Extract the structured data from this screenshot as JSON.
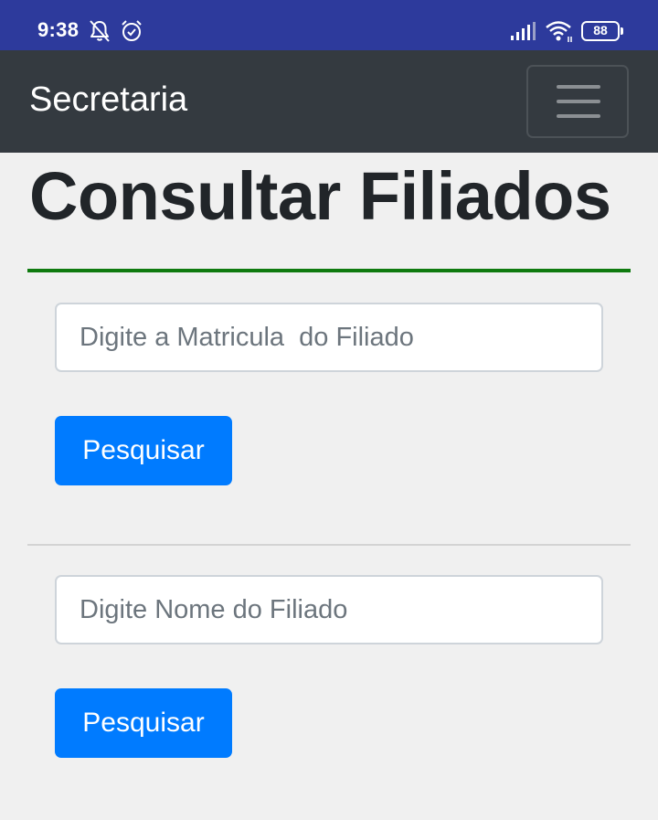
{
  "status_bar": {
    "time": "9:38",
    "battery_level": "88",
    "icons": [
      "bell-off-icon",
      "alarm-icon",
      "signal-icon",
      "wifi-icon",
      "battery-icon"
    ],
    "background_color": "#2d3a9c"
  },
  "navbar": {
    "brand": "Secretaria",
    "menu_icon": "hamburger-menu-icon",
    "background_color": "#343a40"
  },
  "page": {
    "title": "Consultar Filiados",
    "accent_color": "#0f7a0f"
  },
  "search_by_id": {
    "placeholder": "Digite a Matricula  do Filiado",
    "value": "",
    "button_label": "Pesquisar"
  },
  "search_by_name": {
    "placeholder": "Digite Nome do Filiado",
    "value": "",
    "button_label": "Pesquisar"
  },
  "button_color": "#007bff"
}
